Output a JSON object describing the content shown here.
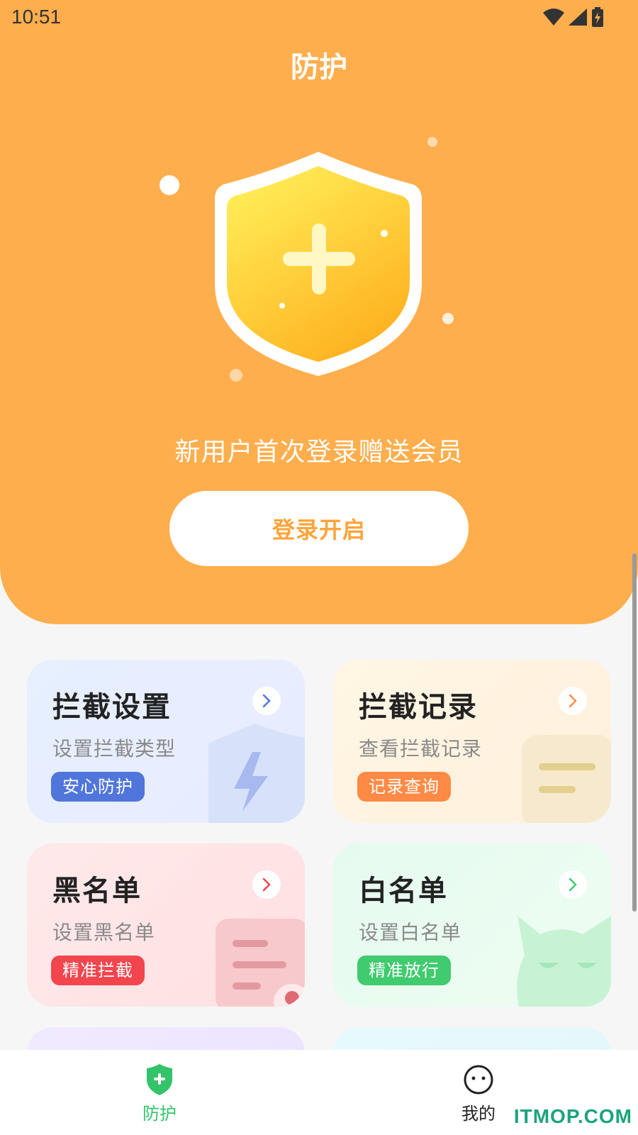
{
  "status_bar": {
    "time": "10:51"
  },
  "header": {
    "title": "防护"
  },
  "hero": {
    "promo_text": "新用户首次登录赠送会员",
    "login_button_label": "登录开启"
  },
  "cards": [
    {
      "title": "拦截设置",
      "subtitle": "设置拦截类型",
      "badge": "安心防护",
      "badge_color": "#5076dc",
      "arrow_color": "#5076dc"
    },
    {
      "title": "拦截记录",
      "subtitle": "查看拦截记录",
      "badge": "记录查询",
      "badge_color": "#ff8a45",
      "arrow_color": "#ff8a45"
    },
    {
      "title": "黑名单",
      "subtitle": "设置黑名单",
      "badge": "精准拦截",
      "badge_color": "#f2454e",
      "arrow_color": "#f2454e"
    },
    {
      "title": "白名单",
      "subtitle": "设置白名单",
      "badge": "精准放行",
      "badge_color": "#3fcb6e",
      "arrow_color": "#3fcb6e"
    }
  ],
  "bottom_nav": {
    "items": [
      {
        "label": "防护",
        "icon": "shield-plus-icon",
        "active": true,
        "color": "#33c46a"
      },
      {
        "label": "我的",
        "icon": "face-icon",
        "active": false,
        "color": "#222222"
      }
    ]
  },
  "watermark": "ITMOP.COM",
  "colors": {
    "hero_background": "#ffae4d",
    "accent": "#ffa43a"
  }
}
